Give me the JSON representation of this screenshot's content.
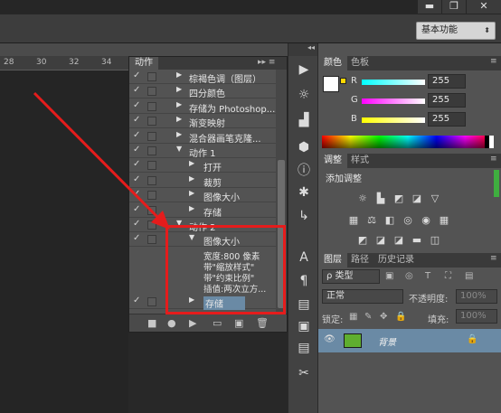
{
  "window": {
    "minimize": "▬",
    "restore": "❐",
    "close": "✕"
  },
  "toolbar": {
    "workspace": "基本功能",
    "workspace_arrow": "⬍"
  },
  "ruler": {
    "ticks": [
      "28",
      "30",
      "32",
      "34"
    ]
  },
  "actions_panel": {
    "tab": "动作",
    "menu_icons": "▸▸ ≡",
    "rows": [
      {
        "check": "✓",
        "tri": "▶",
        "indent": 0,
        "label": "棕褐色调（图层）"
      },
      {
        "check": "✓",
        "tri": "▶",
        "indent": 0,
        "label": "四分颜色"
      },
      {
        "check": "✓",
        "tri": "▶",
        "indent": 0,
        "label": "存储为 Photoshop..."
      },
      {
        "check": "✓",
        "tri": "▶",
        "indent": 0,
        "label": "渐变映射"
      },
      {
        "check": "✓",
        "tri": "▶",
        "indent": 0,
        "label": "混合器画笔克隆..."
      },
      {
        "check": "✓",
        "tri": "▼",
        "indent": 0,
        "label": "动作 1"
      },
      {
        "check": "✓",
        "tri": "▶",
        "indent": 1,
        "label": "打开"
      },
      {
        "check": "✓",
        "tri": "▶",
        "indent": 1,
        "label": "裁剪"
      },
      {
        "check": "✓",
        "tri": "▶",
        "indent": 1,
        "label": "图像大小"
      },
      {
        "check": "✓",
        "tri": "▶",
        "indent": 1,
        "label": "存储"
      },
      {
        "check": "✓",
        "tri": "▼",
        "indent": 0,
        "label": "动作 2"
      },
      {
        "check": "✓",
        "tri": "▼",
        "indent": 1,
        "label": "图像大小"
      }
    ],
    "details": [
      "宽度:800 像素",
      "带\"缩放样式\"",
      "带\"约束比例\"",
      "插值:两次立方..."
    ],
    "last_row": {
      "check": "✓",
      "tri": "▶",
      "label": "存储"
    },
    "footer": [
      "■",
      "●",
      "▶",
      "▭",
      "▣",
      "🗑"
    ]
  },
  "tools": [
    "▶",
    "☼",
    "▟",
    "⬢",
    "ⓘ",
    "✱",
    "↳",
    "A",
    "¶",
    "▤",
    "▣",
    "▤",
    "✂"
  ],
  "color_panel": {
    "tabs": [
      "颜色",
      "色板"
    ],
    "channels": [
      {
        "label": "R",
        "value": "255",
        "grad": "linear-gradient(90deg,#00ffff,#ffffff)"
      },
      {
        "label": "G",
        "value": "255",
        "grad": "linear-gradient(90deg,#ff00ff,#ffffff)"
      },
      {
        "label": "B",
        "value": "255",
        "grad": "linear-gradient(90deg,#ffff00,#ffffff)"
      }
    ]
  },
  "adjust_panel": {
    "tabs": [
      "调整",
      "样式"
    ],
    "title": "添加调整",
    "row1": [
      "☼",
      "▙",
      "◩",
      "◪",
      "▽"
    ],
    "row2": [
      "▦",
      "⚖",
      "◧",
      "◎",
      "◉",
      "▦"
    ],
    "row3": [
      "◩",
      "◪",
      "◪",
      "▬",
      "◫"
    ]
  },
  "layers_panel": {
    "tabs": [
      "图层",
      "路径",
      "历史记录"
    ],
    "filter": "ρ 类型",
    "filter_icons": [
      "▣",
      "◎",
      "T",
      "⛶",
      "▤"
    ],
    "blend": "正常",
    "opacity_label": "不透明度:",
    "opacity": "100%",
    "lock_label": "锁定:",
    "lock_icons": [
      "▦",
      "✎",
      "✥",
      "🔒"
    ],
    "fill_label": "填充:",
    "fill": "100%",
    "layer": {
      "name": "背景",
      "eye": "👁",
      "lock": "🔒"
    }
  }
}
